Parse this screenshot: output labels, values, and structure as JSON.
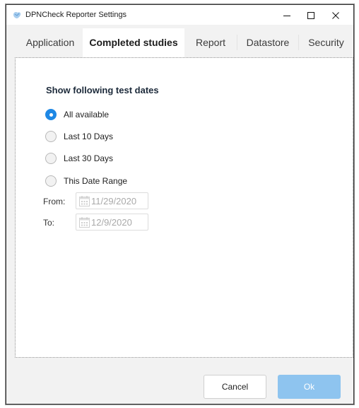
{
  "window": {
    "title": "DPNCheck Reporter Settings",
    "controls": {
      "minimize": "minimize",
      "maximize": "maximize",
      "close": "close"
    }
  },
  "tabs": [
    {
      "label": "Application",
      "active": false
    },
    {
      "label": "Completed studies",
      "active": true
    },
    {
      "label": "Report",
      "active": false
    },
    {
      "label": "Datastore",
      "active": false
    },
    {
      "label": "Security",
      "active": false
    }
  ],
  "completed_studies": {
    "section_title": "Show following test dates",
    "options": [
      {
        "label": "All available",
        "checked": true
      },
      {
        "label": "Last 10 Days",
        "checked": false
      },
      {
        "label": "Last 30 Days",
        "checked": false
      },
      {
        "label": "This Date Range",
        "checked": false
      }
    ],
    "from": {
      "label": "From:",
      "value": "11/29/2020"
    },
    "to": {
      "label": "To:",
      "value": "12/9/2020"
    }
  },
  "footer": {
    "cancel_label": "Cancel",
    "ok_label": "Ok"
  },
  "colors": {
    "accent": "#1e88e5",
    "ok_button": "#8ec4ef",
    "panel_bg": "#ffffff",
    "window_bg": "#f2f2f2"
  }
}
